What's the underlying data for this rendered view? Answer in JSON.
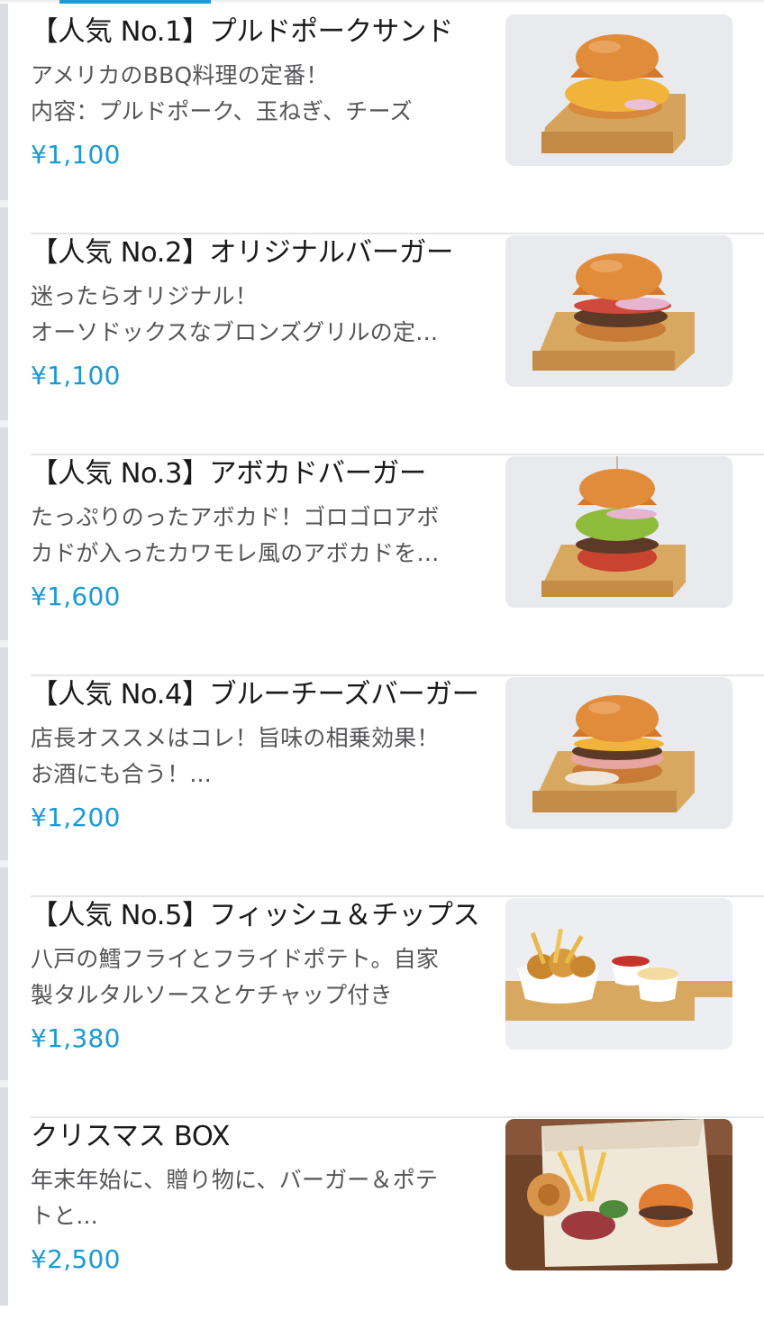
{
  "items": [
    {
      "title": "【人気 No.1】プルドポークサンド",
      "desc1": "アメリカのBBQ料理の定番！",
      "desc2": "内容：プルドポーク、玉ねぎ、チーズ",
      "price": "¥1,100",
      "image": "pulled-pork-sandwich-photo"
    },
    {
      "title": "【人気 No.2】オリジナルバーガー",
      "desc1": "迷ったらオリジナル！",
      "desc2": "オーソドックスなブロンズグリルの定…",
      "price": "¥1,100",
      "image": "original-burger-photo"
    },
    {
      "title": "【人気 No.3】アボカドバーガー",
      "desc1": "たっぷりのったアボカド！ゴロゴロアボ",
      "desc2": "カドが入ったカワモレ風のアボカドを…",
      "price": "¥1,600",
      "image": "avocado-burger-photo"
    },
    {
      "title": "【人気 No.4】ブルーチーズバーガー",
      "desc1": "店長オススメはコレ！旨味の相乗効果！",
      "desc2": "お酒にも合う！...",
      "price": "¥1,200",
      "image": "blue-cheese-burger-photo"
    },
    {
      "title": "【人気 No.5】フィッシュ＆チップス",
      "desc1": "八戸の鱈フライとフライドポテト。自家",
      "desc2": "製タルタルソースとケチャップ付き",
      "price": "¥1,380",
      "image": "fish-and-chips-photo"
    },
    {
      "title": "クリスマス BOX",
      "desc1": "年末年始に、贈り物に、バーガー＆ポテ",
      "desc2": "トと...",
      "price": "¥2,500",
      "image": "christmas-box-photo"
    }
  ],
  "colors": {
    "price": "#1a9ad6",
    "title": "#1a1a1a",
    "description": "#555558",
    "divider": "#e5e5e7",
    "active_tab_indicator": "#1a9ad6"
  }
}
